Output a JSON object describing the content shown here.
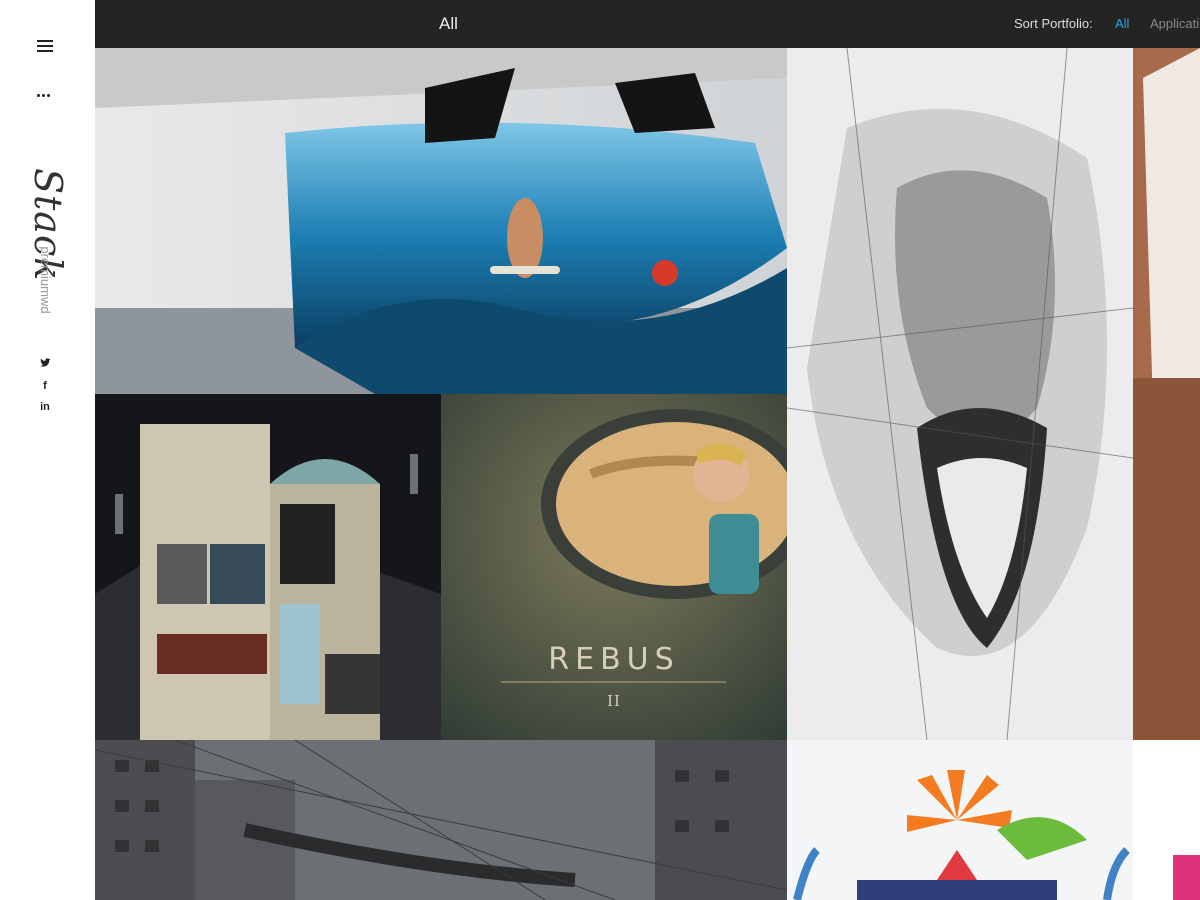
{
  "sidebar": {
    "logo": "Stack",
    "sub_logo": "premiumwd",
    "social": {
      "twitter_icon": "twitter-icon",
      "facebook_label": "f",
      "linkedin_label": "in"
    }
  },
  "topbar": {
    "current_filter": "All",
    "sort_label": "Sort Portfolio:",
    "sort_items": [
      "All",
      "Applicati"
    ],
    "accent_color": "#2aa3e0"
  },
  "portfolio": {
    "rebus_title": "REBUS",
    "rebus_numeral": "II"
  }
}
